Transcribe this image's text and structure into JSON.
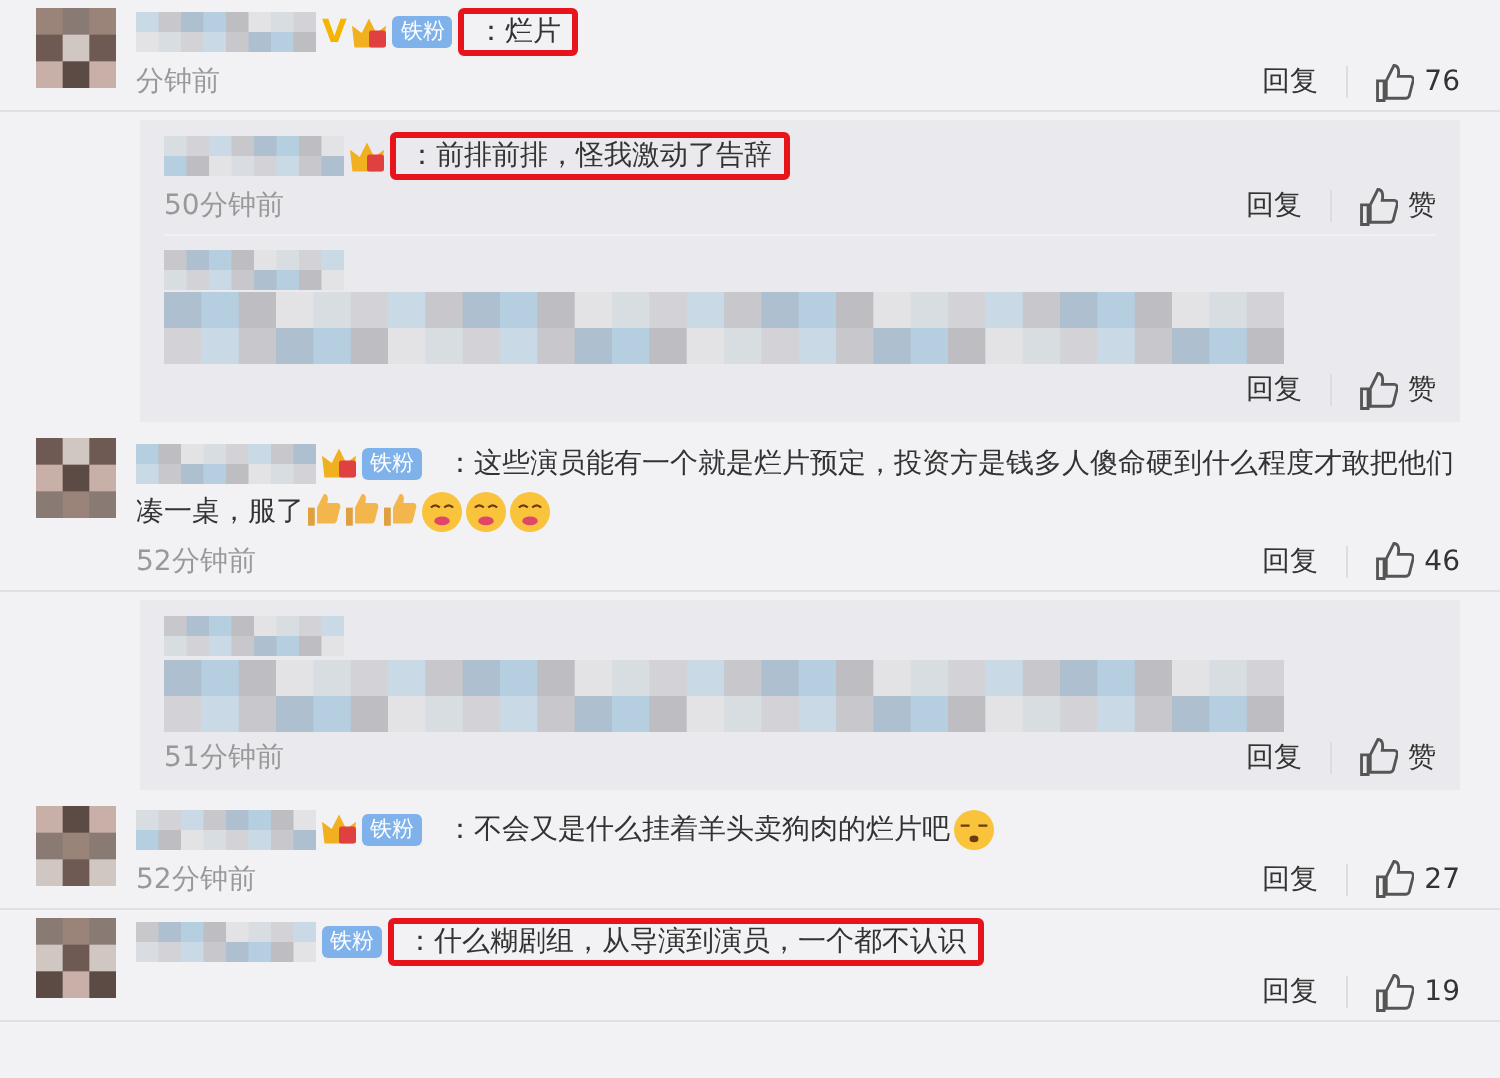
{
  "comments": [
    {
      "vip_mark": "V",
      "crown": true,
      "badge": "铁粉",
      "text": "：烂片",
      "highlighted": true,
      "time": "分钟前",
      "reply_label": "回复",
      "likes": "76",
      "replies": [
        {
          "crown": true,
          "text": "：前排前排，怪我激动了告辞",
          "highlighted": true,
          "time": "50分钟前",
          "reply_label": "回复",
          "likes": "赞"
        },
        {
          "reply_label": "回复",
          "likes": "赞"
        }
      ]
    },
    {
      "crown": true,
      "badge": "铁粉",
      "text": "：这些演员能有一个就是烂片预定，投资方是钱多人傻命硬到什么程度才敢把他们凑一桌，服了",
      "emojis": [
        {
          "kind": "thumbs"
        },
        {
          "kind": "thumbs"
        },
        {
          "kind": "thumbs"
        },
        {
          "kind": "yum"
        },
        {
          "kind": "yum"
        },
        {
          "kind": "yum"
        }
      ],
      "highlighted": false,
      "time": "52分钟前",
      "reply_label": "回复",
      "likes": "46",
      "replies": [
        {
          "time": "51分钟前",
          "reply_label": "回复",
          "likes": "赞"
        }
      ]
    },
    {
      "crown": true,
      "badge": "铁粉",
      "text": "：不会又是什么挂着羊头卖狗肉的烂片吧",
      "emojis": [
        {
          "kind": "sleepy"
        }
      ],
      "highlighted": false,
      "time": "52分钟前",
      "reply_label": "回复",
      "likes": "27"
    },
    {
      "badge": "铁粉",
      "text": "：什么糊剧组，从导演到演员，一个都不认识",
      "highlighted": true,
      "reply_label": "回复",
      "likes": "19"
    }
  ]
}
